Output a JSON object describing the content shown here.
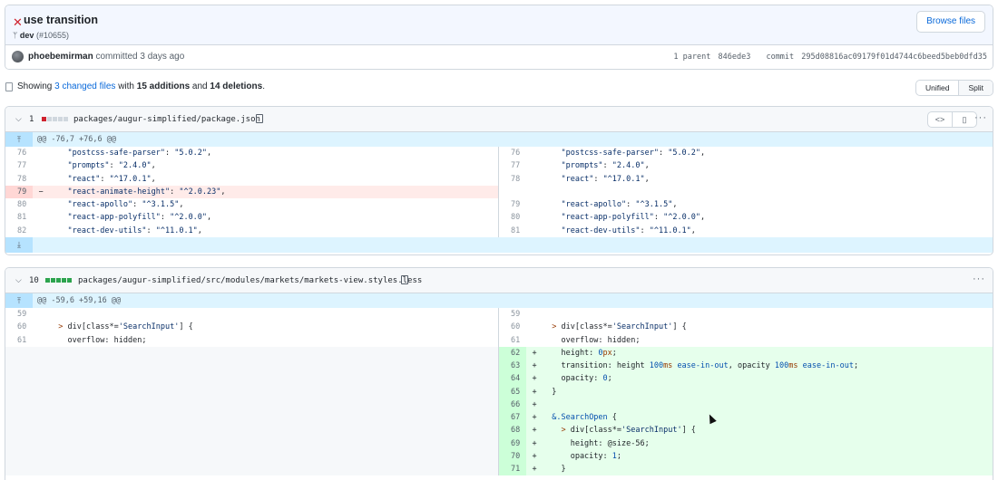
{
  "commit": {
    "title": "use transition",
    "branch": "dev",
    "pr": "(#10655)",
    "browse_label": "Browse files",
    "author": "phoebemirman",
    "committed_text": "committed 3 days ago",
    "parent_label": "1 parent",
    "parent_hash": "846ede3",
    "commit_label": "commit",
    "commit_hash": "295d08816ac09179f01d4744c6beed5beb0dfd35"
  },
  "stats": {
    "prefix": "Showing",
    "changed": "3 changed files",
    "mid1": "with",
    "additions": "15 additions",
    "mid2": "and",
    "deletions": "14 deletions",
    "suffix": ".",
    "view_unified": "Unified",
    "view_split": "Split"
  },
  "files": [
    {
      "count": "1",
      "path": "packages/augur-simplified/package.json",
      "hunk": "@@ -76,7 +76,6 @@",
      "rows": [
        {
          "type": "ctx",
          "ln": "76",
          "rn": "76",
          "code": "    \"postcss-safe-parser\": \"5.0.2\","
        },
        {
          "type": "ctx",
          "ln": "77",
          "rn": "77",
          "code": "    \"prompts\": \"2.4.0\","
        },
        {
          "type": "ctx",
          "ln": "78",
          "rn": "78",
          "code": "    \"react\": \"^17.0.1\","
        },
        {
          "type": "del",
          "ln": "79",
          "rn": "",
          "code": "    \"react-animate-height\": \"^2.0.23\","
        },
        {
          "type": "ctx",
          "ln": "80",
          "rn": "79",
          "code": "    \"react-apollo\": \"^3.1.5\","
        },
        {
          "type": "ctx",
          "ln": "81",
          "rn": "80",
          "code": "    \"react-app-polyfill\": \"^2.0.0\","
        },
        {
          "type": "ctx",
          "ln": "82",
          "rn": "81",
          "code": "    \"react-dev-utils\": \"^11.0.1\","
        }
      ]
    },
    {
      "count": "10",
      "path": "packages/augur-simplified/src/modules/markets/markets-view.styles.less",
      "hunk": "@@ -59,6 +59,16 @@",
      "rows": [
        {
          "type": "ctx",
          "ln": "59",
          "rn": "59",
          "code": ""
        },
        {
          "type": "ctx",
          "ln": "60",
          "rn": "60",
          "code": "  > div[class*='SearchInput'] {"
        },
        {
          "type": "ctx",
          "ln": "61",
          "rn": "61",
          "code": "    overflow: hidden;"
        },
        {
          "type": "add",
          "ln": "",
          "rn": "62",
          "code": "    height: 0px;"
        },
        {
          "type": "add",
          "ln": "",
          "rn": "63",
          "code": "    transition: height 100ms ease-in-out, opacity 100ms ease-in-out;"
        },
        {
          "type": "add",
          "ln": "",
          "rn": "64",
          "code": "    opacity: 0;"
        },
        {
          "type": "add",
          "ln": "",
          "rn": "65",
          "code": "  }"
        },
        {
          "type": "add",
          "ln": "",
          "rn": "66",
          "code": ""
        },
        {
          "type": "add",
          "ln": "",
          "rn": "67",
          "code": "  &.SearchOpen {"
        },
        {
          "type": "add",
          "ln": "",
          "rn": "68",
          "code": "    > div[class*='SearchInput'] {"
        },
        {
          "type": "add",
          "ln": "",
          "rn": "69",
          "code": "      height: @size-56;"
        },
        {
          "type": "add",
          "ln": "",
          "rn": "70",
          "code": "      opacity: 1;"
        },
        {
          "type": "add",
          "ln": "",
          "rn": "71",
          "code": "    }"
        }
      ]
    }
  ],
  "colors": {
    "add_bar": "#2da44e",
    "del_bar": "#cf222e",
    "neutral_bar": "#d0d7de"
  }
}
